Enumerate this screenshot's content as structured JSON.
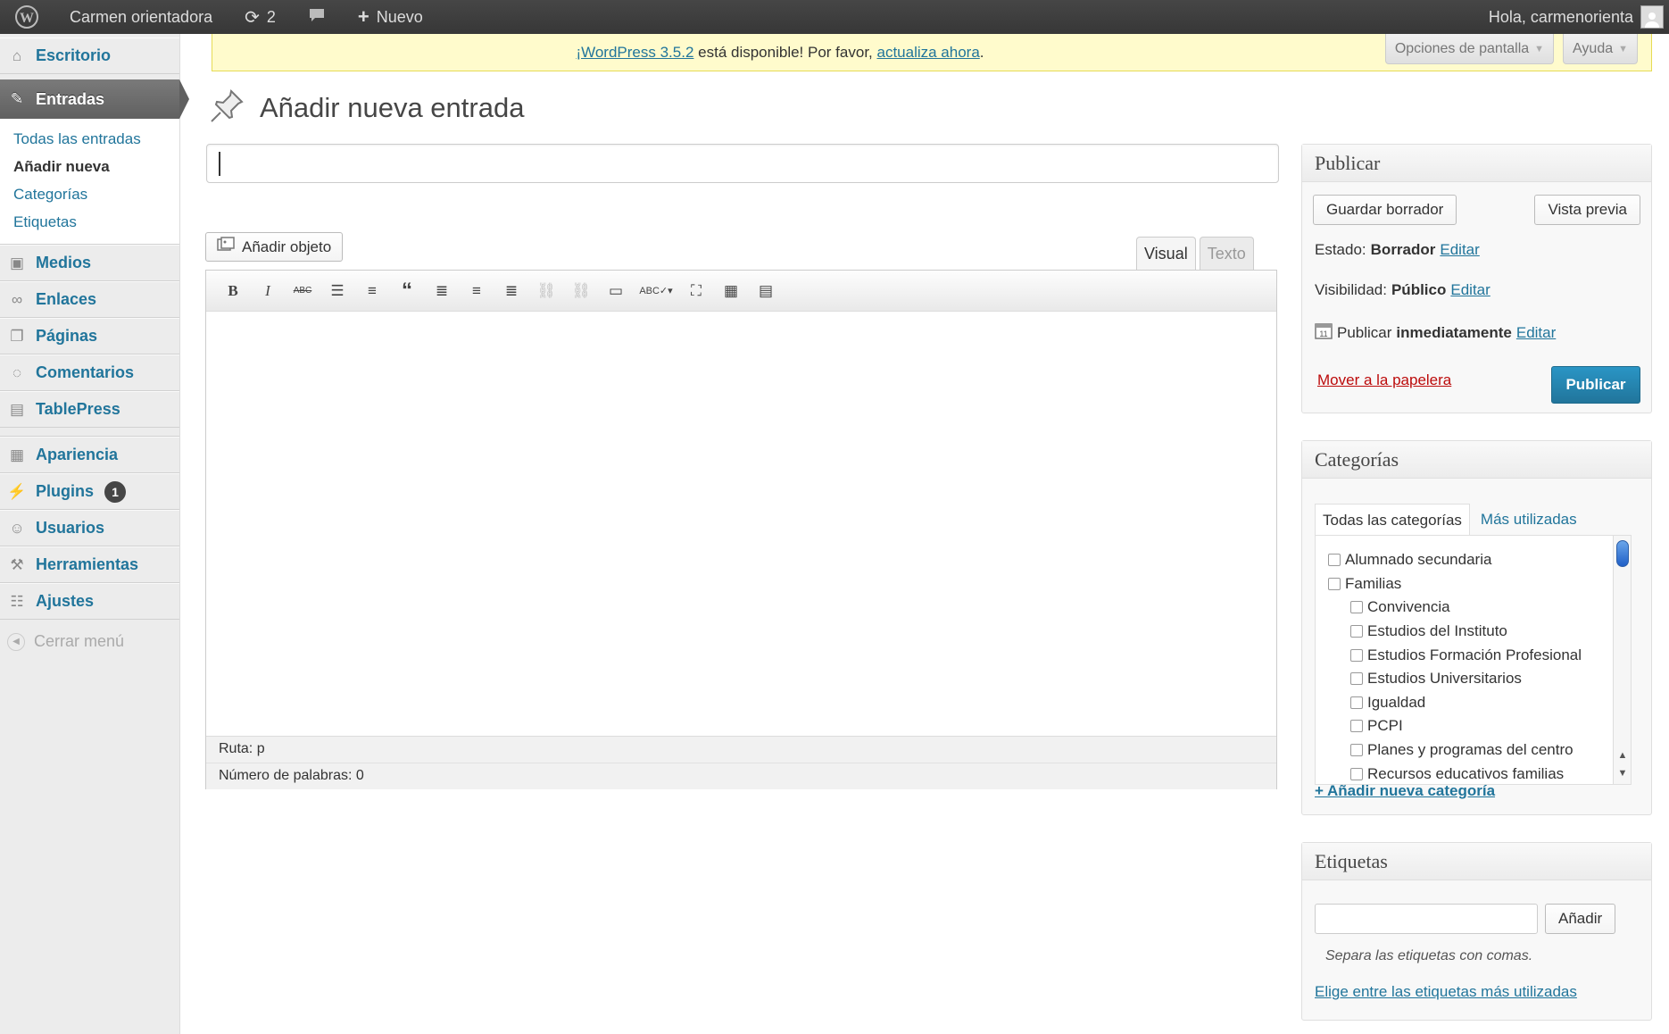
{
  "adminbar": {
    "site_name": "Carmen orientadora",
    "updates_count": "2",
    "new_label": "Nuevo",
    "greeting": "Hola, carmenorienta"
  },
  "sidebar": {
    "dashboard": "Escritorio",
    "posts": "Entradas",
    "posts_sub": [
      "Todas las entradas",
      "Añadir nueva",
      "Categorías",
      "Etiquetas"
    ],
    "media": "Medios",
    "links": "Enlaces",
    "pages": "Páginas",
    "comments": "Comentarios",
    "tablepress": "TablePress",
    "appearance": "Apariencia",
    "plugins": "Plugins",
    "plugins_badge": "1",
    "users": "Usuarios",
    "tools": "Herramientas",
    "settings": "Ajustes",
    "collapse": "Cerrar menú"
  },
  "notice": {
    "link1": "¡WordPress 3.5.2",
    "middle": " está disponible! Por favor, ",
    "link2": "actualiza ahora",
    "end": "."
  },
  "screen_options": "Opciones de pantalla",
  "help": "Ayuda",
  "page_title": "Añadir nueva entrada",
  "editor": {
    "title_value": "",
    "add_media": "Añadir objeto",
    "tab_visual": "Visual",
    "tab_text": "Texto",
    "path": "Ruta: p",
    "word_count": "Número de palabras: 0"
  },
  "publish": {
    "title": "Publicar",
    "save_draft": "Guardar borrador",
    "preview": "Vista previa",
    "status_label": "Estado:",
    "status_value": "Borrador",
    "visibility_label": "Visibilidad:",
    "visibility_value": "Público",
    "publish_label": "Publicar",
    "publish_value": "inmediatamente",
    "edit": "Editar",
    "trash": "Mover a la papelera",
    "publish_button": "Publicar"
  },
  "categories": {
    "title": "Categorías",
    "tab_all": "Todas las categorías",
    "tab_popular": "Más utilizadas",
    "items": [
      {
        "label": "Alumnado secundaria",
        "level": 0
      },
      {
        "label": "Familias",
        "level": 0
      },
      {
        "label": "Convivencia",
        "level": 1
      },
      {
        "label": "Estudios del Instituto",
        "level": 1
      },
      {
        "label": "Estudios Formación Profesional",
        "level": 1
      },
      {
        "label": "Estudios Universitarios",
        "level": 1
      },
      {
        "label": "Igualdad",
        "level": 1
      },
      {
        "label": "PCPI",
        "level": 1
      },
      {
        "label": "Planes y programas del centro",
        "level": 1
      },
      {
        "label": "Recursos educativos familias",
        "level": 1
      }
    ],
    "add_new": "+ Añadir nueva categoría"
  },
  "tags": {
    "title": "Etiquetas",
    "input_value": "",
    "add_button": "Añadir",
    "hint": "Separa las etiquetas con comas.",
    "choose_link": "Elige entre las etiquetas más utilizadas"
  },
  "colors": {
    "accent": "#21759b",
    "notice_bg": "#fffbcc",
    "trash": "#bc0b0b",
    "adminbar": "#464646"
  }
}
